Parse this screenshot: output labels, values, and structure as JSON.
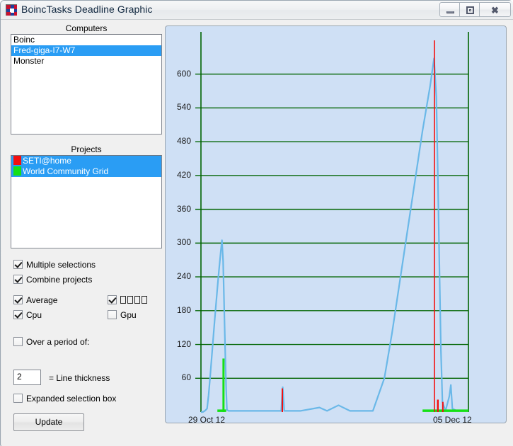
{
  "window": {
    "title": "BoincTasks Deadline Graphic",
    "icon": "boinc-app-icon",
    "minimize_label": "–",
    "maximize_label": "□",
    "close_label": "✕"
  },
  "computers": {
    "group_label": "Computers",
    "items": [
      {
        "label": "Boinc",
        "selected": false
      },
      {
        "label": "Fred-giga-I7-W7",
        "selected": true
      },
      {
        "label": "Monster",
        "selected": false
      }
    ]
  },
  "projects": {
    "group_label": "Projects",
    "items": [
      {
        "label": "SETI@home",
        "color": "#f30f0f",
        "selected": true
      },
      {
        "label": "World Community Grid",
        "color": "#16e016",
        "selected": true
      }
    ]
  },
  "options": {
    "multiple_selections": {
      "label": "Multiple selections",
      "checked": true
    },
    "combine_projects": {
      "label": "Combine projects",
      "checked": true
    },
    "average": {
      "label": "Average",
      "checked": true
    },
    "unknown_glyphs": {
      "label": "□□□□",
      "checked": true
    },
    "cpu": {
      "label": "Cpu",
      "checked": true
    },
    "gpu": {
      "label": "Gpu",
      "checked": false
    },
    "over_a_period": {
      "label": "Over a period of:",
      "checked": false
    },
    "expanded_selection_box": {
      "label": "Expanded selection box",
      "checked": false
    }
  },
  "line_thickness": {
    "value": "2",
    "label": "= Line thickness"
  },
  "update_button": {
    "label": "Update"
  },
  "chart_data": {
    "type": "line",
    "title": "",
    "xlabel": "",
    "ylabel": "",
    "grid": true,
    "legend_position": "none",
    "background_color": "#cfe0f5",
    "axis_color": "#006400",
    "ylim": [
      0,
      660
    ],
    "yticks": [
      60,
      120,
      180,
      240,
      300,
      360,
      420,
      480,
      540,
      600
    ],
    "xticks": [
      "29 Oct 12",
      "05 Dec 12"
    ],
    "xlim": [
      "29 Oct 12",
      "05 Dec 12"
    ],
    "series": [
      {
        "name": "Average",
        "color": "#6ab8e8",
        "type": "line",
        "points": [
          [
            0.0,
            0
          ],
          [
            0.5,
            0
          ],
          [
            1.0,
            2
          ],
          [
            1.6,
            6
          ],
          [
            2.0,
            30
          ],
          [
            2.4,
            62
          ],
          [
            2.8,
            96
          ],
          [
            3.2,
            130
          ],
          [
            3.6,
            164
          ],
          [
            4.0,
            196
          ],
          [
            4.4,
            228
          ],
          [
            4.8,
            258
          ],
          [
            5.2,
            286
          ],
          [
            5.5,
            305
          ],
          [
            5.8,
            268
          ],
          [
            6.0,
            210
          ],
          [
            6.2,
            150
          ],
          [
            6.4,
            92
          ],
          [
            6.6,
            40
          ],
          [
            6.8,
            4
          ],
          [
            7.2,
            2
          ],
          [
            9.0,
            2
          ],
          [
            14.0,
            2
          ],
          [
            18.0,
            2
          ],
          [
            21.0,
            2
          ],
          [
            21.4,
            44
          ],
          [
            21.8,
            2
          ],
          [
            26.0,
            2
          ],
          [
            31.0,
            8
          ],
          [
            33.0,
            2
          ],
          [
            36.0,
            12
          ],
          [
            39.0,
            2
          ],
          [
            45.0,
            2
          ],
          [
            48.0,
            60
          ],
          [
            50.0,
            140
          ],
          [
            52.0,
            230
          ],
          [
            54.0,
            320
          ],
          [
            56.0,
            410
          ],
          [
            58.0,
            500
          ],
          [
            60.0,
            580
          ],
          [
            61.0,
            628
          ],
          [
            61.6,
            560
          ],
          [
            62.0,
            420
          ],
          [
            62.4,
            260
          ],
          [
            62.8,
            110
          ],
          [
            63.2,
            18
          ],
          [
            64.0,
            2
          ],
          [
            65.0,
            28
          ],
          [
            65.4,
            48
          ],
          [
            65.8,
            6
          ],
          [
            67.0,
            2
          ],
          [
            70.0,
            2
          ]
        ]
      },
      {
        "name": "World Community Grid",
        "color": "#16e016",
        "type": "bars",
        "bars": [
          {
            "x": 5.9,
            "height": 95,
            "width": 0.55
          }
        ],
        "baseline_segments": [
          {
            "x0": 4.3,
            "x1": 6.6,
            "y": 2
          },
          {
            "x0": 58.0,
            "x1": 70.0,
            "y": 2
          }
        ]
      },
      {
        "name": "SETI@home",
        "color": "#f30f0f",
        "type": "bars",
        "bars": [
          {
            "x": 21.3,
            "height": 42,
            "width": 0.3
          },
          {
            "x": 62.0,
            "height": 22,
            "width": 0.45
          },
          {
            "x": 63.3,
            "height": 18,
            "width": 0.3
          }
        ],
        "markers": [
          {
            "x": 61.1,
            "y0": 0,
            "y1": 660
          }
        ]
      }
    ]
  }
}
